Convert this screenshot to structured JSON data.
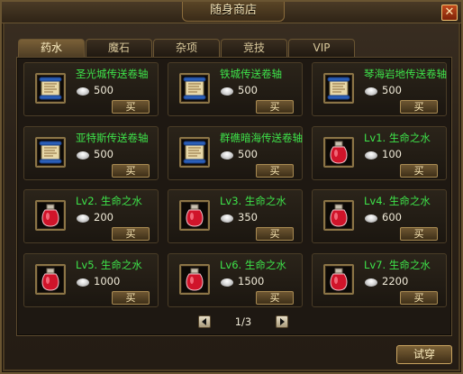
{
  "window": {
    "title": "随身商店",
    "close_label": "✕"
  },
  "tabs": [
    {
      "label": "药水",
      "active": true
    },
    {
      "label": "魔石",
      "active": false
    },
    {
      "label": "杂项",
      "active": false
    },
    {
      "label": "竞技",
      "active": false
    },
    {
      "label": "VIP",
      "active": false
    }
  ],
  "items": [
    {
      "name": "圣光城传送卷轴",
      "price": "500",
      "icon": "scroll-icon",
      "buy_label": "买"
    },
    {
      "name": "铁城传送卷轴",
      "price": "500",
      "icon": "scroll-icon",
      "buy_label": "买"
    },
    {
      "name": "琴海岩地传送卷轴",
      "price": "500",
      "icon": "scroll-icon",
      "buy_label": "买"
    },
    {
      "name": "亚特斯传送卷轴",
      "price": "500",
      "icon": "scroll-icon",
      "buy_label": "买"
    },
    {
      "name": "群礁暗海传送卷轴",
      "price": "500",
      "icon": "scroll-icon",
      "buy_label": "买"
    },
    {
      "name": "Lv1. 生命之水",
      "price": "100",
      "icon": "red-potion-icon",
      "buy_label": "买"
    },
    {
      "name": "Lv2. 生命之水",
      "price": "200",
      "icon": "red-potion-icon",
      "buy_label": "买"
    },
    {
      "name": "Lv3. 生命之水",
      "price": "350",
      "icon": "red-potion-icon",
      "buy_label": "买"
    },
    {
      "name": "Lv4. 生命之水",
      "price": "600",
      "icon": "red-potion-icon",
      "buy_label": "买"
    },
    {
      "name": "Lv5. 生命之水",
      "price": "1000",
      "icon": "red-potion-icon",
      "buy_label": "买"
    },
    {
      "name": "Lv6. 生命之水",
      "price": "1500",
      "icon": "red-potion-icon",
      "buy_label": "买"
    },
    {
      "name": "Lv7. 生命之水",
      "price": "2200",
      "icon": "red-potion-icon",
      "buy_label": "买"
    }
  ],
  "pager": {
    "page": "1/3"
  },
  "actions": {
    "try_on_label": "试穿"
  },
  "colors": {
    "item_name": "#3ee34a",
    "price": "#f0ead8",
    "frame": "#8b7446"
  }
}
